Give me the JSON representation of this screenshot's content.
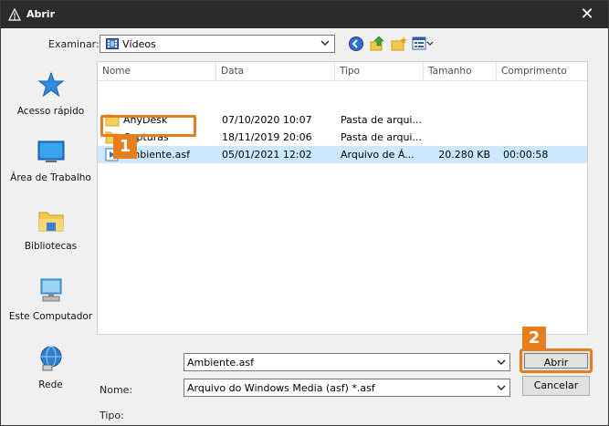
{
  "window": {
    "title": "Abrir",
    "close_glyph": "✕"
  },
  "toolbar": {
    "look_in_label": "Examinar:",
    "look_in_value": "Vídeos",
    "icons": [
      "back-icon",
      "up-folder-icon",
      "new-folder-icon",
      "view-menu-icon"
    ]
  },
  "places": [
    {
      "label": "Acesso rápido",
      "icon": "star-icon"
    },
    {
      "label": "Área de Trabalho",
      "icon": "desktop-icon"
    },
    {
      "label": "Bibliotecas",
      "icon": "libraries-icon"
    },
    {
      "label": "Este Computador",
      "icon": "computer-icon"
    },
    {
      "label": "Rede",
      "icon": "network-icon"
    }
  ],
  "columns": [
    "Nome",
    "Data",
    "Tipo",
    "Tamanho",
    "Comprimento"
  ],
  "files": [
    {
      "name": "AnyDesk",
      "date": "07/10/2020 10:07",
      "type": "Pasta de arqui...",
      "size": "",
      "length": "",
      "kind": "folder"
    },
    {
      "name": "Capturas",
      "date": "18/11/2019 20:06",
      "type": "Pasta de arqui...",
      "size": "",
      "length": "",
      "kind": "folder"
    },
    {
      "name": "Ambiente.asf",
      "date": "05/01/2021 12:02",
      "type": "Arquivo de Á...",
      "size": "20.280 KB",
      "length": "00:00:58",
      "kind": "media",
      "selected": true
    }
  ],
  "form": {
    "name_label": "Nome:",
    "name_value": "Ambiente.asf",
    "type_label": "Tipo:",
    "type_value": "Arquivo do Windows Media (asf) *.asf"
  },
  "buttons": {
    "open": "Abrir",
    "cancel": "Cancelar"
  },
  "annotations": {
    "step1": "1",
    "step2": "2",
    "accent_color": "#e57f1e"
  }
}
